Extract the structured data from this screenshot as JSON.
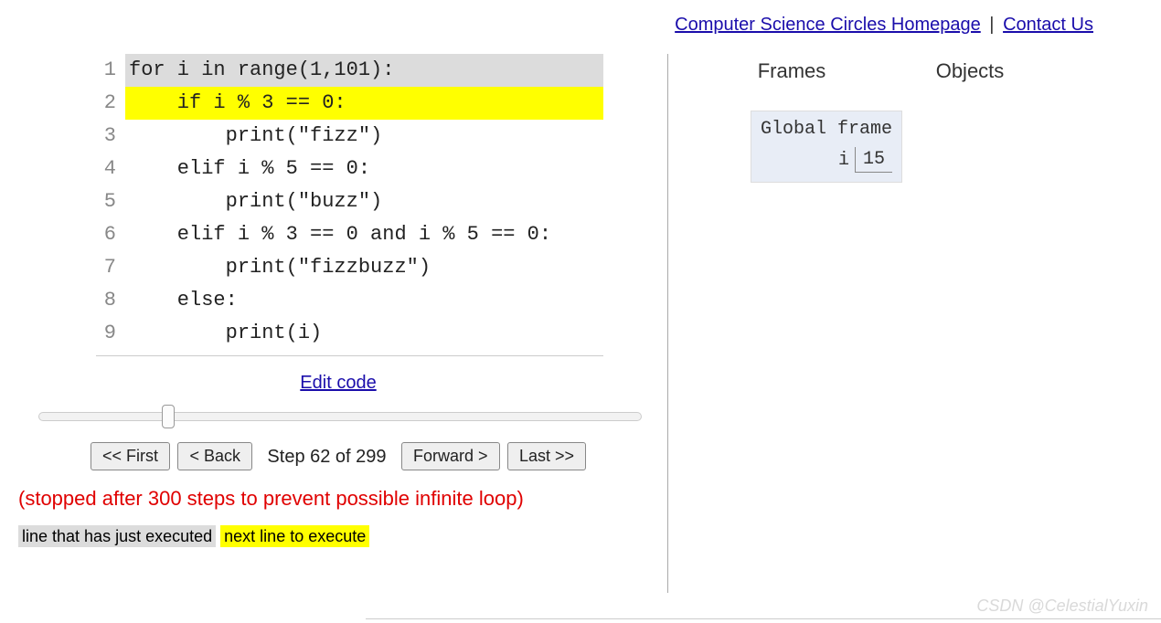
{
  "top": {
    "homepage_label": "Computer Science Circles Homepage",
    "separator": " | ",
    "contact_label": "Contact Us"
  },
  "code": {
    "lines": [
      {
        "n": "1",
        "text": "for i in range(1,101):",
        "hl": "executed"
      },
      {
        "n": "2",
        "text": "    if i % 3 == 0:",
        "hl": "next"
      },
      {
        "n": "3",
        "text": "        print(\"fizz\")",
        "hl": ""
      },
      {
        "n": "4",
        "text": "    elif i % 5 == 0:",
        "hl": ""
      },
      {
        "n": "5",
        "text": "        print(\"buzz\")",
        "hl": ""
      },
      {
        "n": "6",
        "text": "    elif i % 3 == 0 and i % 5 == 0:",
        "hl": ""
      },
      {
        "n": "7",
        "text": "        print(\"fizzbuzz\")",
        "hl": ""
      },
      {
        "n": "8",
        "text": "    else:",
        "hl": ""
      },
      {
        "n": "9",
        "text": "        print(i)",
        "hl": ""
      }
    ],
    "edit_label": "Edit code"
  },
  "controls": {
    "first": "<< First",
    "back": "< Back",
    "step_label": "Step 62 of 299",
    "forward": "Forward >",
    "last": "Last >>",
    "slider_value": 62,
    "slider_max": 299
  },
  "warning": "(stopped after 300 steps to prevent possible infinite loop)",
  "legend": {
    "executed": "line that has just executed",
    "next": "next line to execute"
  },
  "right": {
    "frames_header": "Frames",
    "objects_header": "Objects",
    "frame_title": "Global frame",
    "var_name": "i",
    "var_value": "15"
  },
  "watermark": "CSDN @CelestialYuxin"
}
